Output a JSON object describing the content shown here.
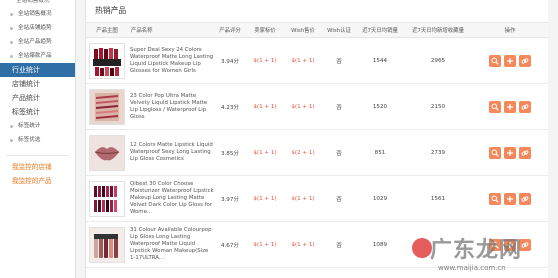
{
  "sidebar": {
    "partial_item": "全站销售概况",
    "sub_items_top": [
      "全站销售概况",
      "全站店铺趋势",
      "全站产品趋势",
      "全站爆款产品"
    ],
    "main_items": [
      "行业统计",
      "店铺统计",
      "产品统计",
      "标签统计"
    ],
    "active_main": "行业统计",
    "tag_sub_items": [
      "标签统计",
      "标签优选"
    ],
    "links": [
      "我监控的店铺",
      "我监控的产品"
    ]
  },
  "panel": {
    "title": "热销产品"
  },
  "table": {
    "headers": [
      "产品主图",
      "产品名称",
      "产品评分",
      "卖家标价",
      "Wish售价",
      "Wish认证",
      "近7天日均销量",
      "近7天日均新增收藏量",
      "操作"
    ],
    "rows": [
      {
        "name": "Super Deal Sexy 24 Colors Waterproof Matte Long Lasting Liquid Lipstick Makeup Lip Glosses for Women Girls",
        "score": "3.94分",
        "seller_price": "$(1 + 1)",
        "wish_price": "$(1 + 1)",
        "verified": "否",
        "sales7": "1544",
        "fav7": "2965",
        "thumb": "lipstick-set"
      },
      {
        "name": "23 Color Pop Ultra Matte Velvety Liquid Lipstick Matte Lip Lipgloss / Waterproof Lip Gloss",
        "score": "4.23分",
        "seller_price": "$(1 + 1)",
        "wish_price": "$(1 + 1)",
        "verified": "否",
        "sales7": "1520",
        "fav7": "2150",
        "thumb": "lip-swatch"
      },
      {
        "name": "12 Colors Matte Lipstick Liquid Waterproof Sexy Long Lasting Lip Gloss Cosmetics",
        "score": "3.85分",
        "seller_price": "$(1 + 1)",
        "wish_price": "$(2 + 1)",
        "verified": "否",
        "sales7": "851",
        "fav7": "2739",
        "thumb": "lips"
      },
      {
        "name": "Qibest 30 Color Choose Moisturizer Waterproof Lipstick Makeup Long Lasting Matte Velvet Dark Color Lip Gloss for Wome...",
        "score": "3.97分",
        "seller_price": "$(1 + 1)",
        "wish_price": "$(1 + 1)",
        "verified": "否",
        "sales7": "1029",
        "fav7": "1561",
        "thumb": "lipstick-pack"
      },
      {
        "name": "31 Colour Available Colourpop Lip Gloss Long Lasting Waterproof Matte Liquid Lipstick Woman Makeup(Size 1-17ULTRA...",
        "score": "4.67分",
        "seller_price": "$(1 + 1)",
        "wish_price": "$(1 + 1)",
        "verified": "否",
        "sales7": "1089",
        "fav7": "",
        "thumb": "tubes"
      }
    ],
    "op_icons": [
      "search-icon",
      "plus-icon",
      "link-icon"
    ]
  },
  "watermark": {
    "text": "广东龙网",
    "url": "www.maijia.com.cn"
  },
  "colors": {
    "accent": "#2f6fa6",
    "price": "#e8503a",
    "op_button": "#f4885a",
    "side_link": "#e97b22"
  }
}
